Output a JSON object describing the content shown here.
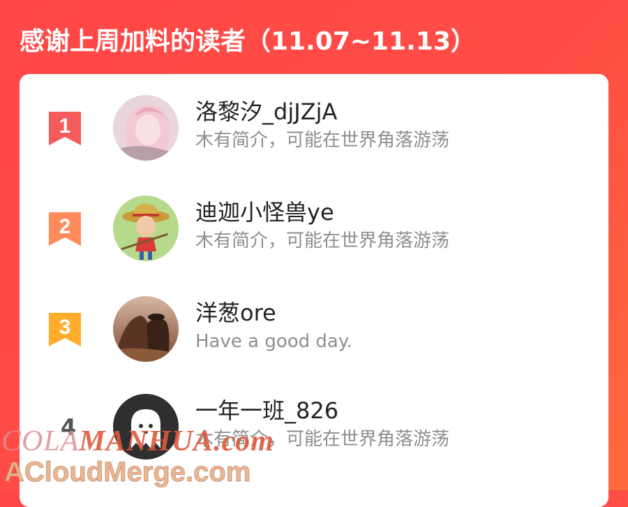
{
  "header": {
    "title": "感谢上周加料的读者（11.07~11.13）"
  },
  "readers": [
    {
      "rank": "1",
      "name": "洛黎汐_djJZjA",
      "bio": "木有简介，可能在世界角落游荡",
      "badge_color": "#f45b5b"
    },
    {
      "rank": "2",
      "name": "迪迦小怪兽ye",
      "bio": "木有简介，可能在世界角落游荡",
      "badge_color": "#ff8a5b"
    },
    {
      "rank": "3",
      "name": "洋葱ore",
      "bio": "Have a good day.",
      "badge_color": "#ffad2a"
    },
    {
      "rank": "4",
      "name": "一年一班_826",
      "bio": "木有简介，可能在世界角落游荡"
    }
  ],
  "watermark": {
    "line1_prefix": "COLA",
    "line1_strong": "MANHUA.com",
    "line2": "ACloudMerge.com"
  },
  "colors": {
    "background": "#ff4d45",
    "card": "#ffffff",
    "name_text": "#222222",
    "bio_text": "#8e8e8e"
  },
  "icons": {
    "rank_badge": "ribbon-bookmark-icon",
    "avatar_placeholder": "ghost-face-icon"
  }
}
